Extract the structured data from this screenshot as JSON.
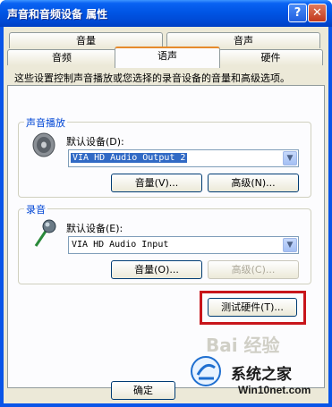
{
  "window": {
    "title": "声音和音频设备 属性",
    "help_glyph": "?",
    "close_glyph": "✕"
  },
  "tabs": {
    "row1": [
      {
        "label": "音量"
      },
      {
        "label": "音声"
      }
    ],
    "row2": [
      {
        "label": "音频"
      },
      {
        "label": "语声"
      },
      {
        "label": "硬件"
      }
    ],
    "active": "语声"
  },
  "description": "这些设置控制声音播放或您选择的录音设备的音量和高级选项。",
  "playback": {
    "legend": "声音播放",
    "device_label": "默认设备(D):",
    "device_value": "VIA HD Audio Output 2",
    "volume_button": "音量(V)...",
    "advanced_button": "高级(N)..."
  },
  "recording": {
    "legend": "录音",
    "device_label": "默认设备(E):",
    "device_value": "VIA HD Audio Input",
    "volume_button": "音量(O)...",
    "advanced_button": "高级(C)..."
  },
  "test_hardware_button": "测试硬件(T)...",
  "ok_button": "确定",
  "watermark": {
    "brand": "系统之家",
    "url": "Win10net.com",
    "faint": "Bai 经验"
  },
  "colors": {
    "title_bar": "#0055e5",
    "group_legend": "#0046d5",
    "highlight_box": "#c8151b"
  },
  "icons": {
    "playback": "speaker-icon",
    "recording": "microphone-icon"
  }
}
